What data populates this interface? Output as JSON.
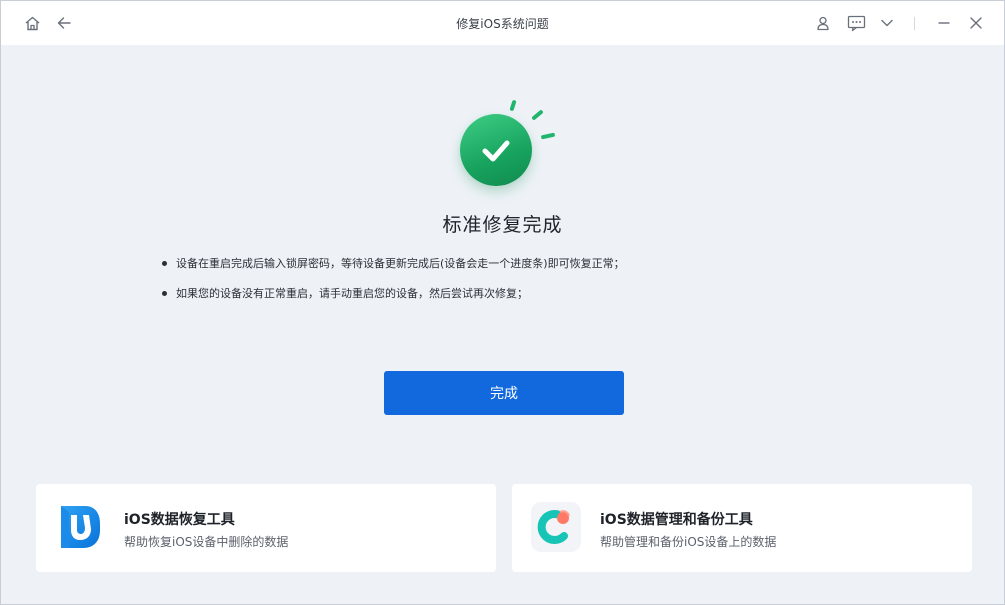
{
  "window": {
    "title": "修复iOS系统问题",
    "nav_icons": [
      "home-icon",
      "back-arrow-icon"
    ],
    "control_icons": [
      "user-icon",
      "feedback-icon",
      "chevron-down-icon",
      "minimize-icon",
      "close-icon"
    ]
  },
  "result": {
    "heading": "标准修复完成",
    "status_icon": "success-check-icon",
    "accent_color": "#1fb56c",
    "bullets": [
      "设备在重启完成后输入锁屏密码，等待设备更新完成后(设备会走一个进度条)即可恢复正常；",
      "如果您的设备没有正常重启，请手动重启您的设备，然后尝试再次修复；"
    ]
  },
  "primary_button": {
    "label": "完成",
    "color": "#1269dd"
  },
  "promo_cards": [
    {
      "icon": "data-recovery-app-icon",
      "title": "iOS数据恢复工具",
      "subtitle": "帮助恢复iOS设备中删除的数据"
    },
    {
      "icon": "data-manager-app-icon",
      "title": "iOS数据管理和备份工具",
      "subtitle": "帮助管理和备份iOS设备上的数据"
    }
  ]
}
